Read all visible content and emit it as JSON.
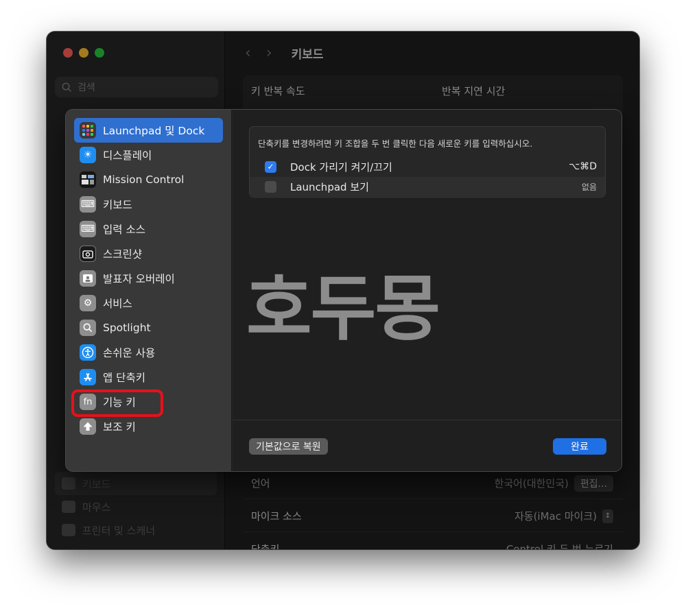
{
  "window": {
    "header_title": "키보드"
  },
  "background": {
    "search_placeholder": "검색",
    "repeat_speed_label": "키 반복 속도",
    "repeat_delay_label": "반복 지연 시간",
    "sidebar_items": [
      {
        "label": "키보드",
        "selected": true
      },
      {
        "label": "마우스",
        "selected": false
      },
      {
        "label": "프린터 및 스캐너",
        "selected": false
      }
    ],
    "rows": [
      {
        "label": "언어",
        "value": "한국어(대한민국)",
        "button": "편집..."
      },
      {
        "label": "마이크 소스",
        "value": "자동(iMac 마이크)"
      },
      {
        "label": "단축키",
        "value": "Control 키 두 번 누르기"
      }
    ]
  },
  "modal": {
    "sidebar_items": [
      {
        "label": "Launchpad 및 Dock",
        "icon": "launchpad-icon",
        "selected": true
      },
      {
        "label": "디스플레이",
        "icon": "sun-icon"
      },
      {
        "label": "Mission Control",
        "icon": "mission-control-icon"
      },
      {
        "label": "키보드",
        "icon": "keyboard-icon"
      },
      {
        "label": "입력 소스",
        "icon": "keyboard-icon"
      },
      {
        "label": "스크린샷",
        "icon": "camera-icon"
      },
      {
        "label": "발표자 오버레이",
        "icon": "presenter-icon"
      },
      {
        "label": "서비스",
        "icon": "gears-icon"
      },
      {
        "label": "Spotlight",
        "icon": "magnifier-icon"
      },
      {
        "label": "손쉬운 사용",
        "icon": "accessibility-icon"
      },
      {
        "label": "앱 단축키",
        "icon": "app-store-icon"
      },
      {
        "label": "기능 키",
        "icon": "fn-icon"
      },
      {
        "label": "보조 키",
        "icon": "up-arrow-icon"
      }
    ],
    "info_text": "단축키를 변경하려면 키 조합을 두 번 클릭한 다음 새로운 키를 입력하십시오.",
    "shortcuts": [
      {
        "label": "Dock 가리기 켜기/끄기",
        "key": "⌥⌘D",
        "checked": true
      },
      {
        "label": "Launchpad 보기",
        "key": "없음",
        "checked": false
      }
    ],
    "watermark": "호두몽",
    "reset_button": "기본값으로 복원",
    "done_button": "완료"
  },
  "colors": {
    "accent": "#2f6fcf",
    "highlight_border": "#e8101a"
  }
}
